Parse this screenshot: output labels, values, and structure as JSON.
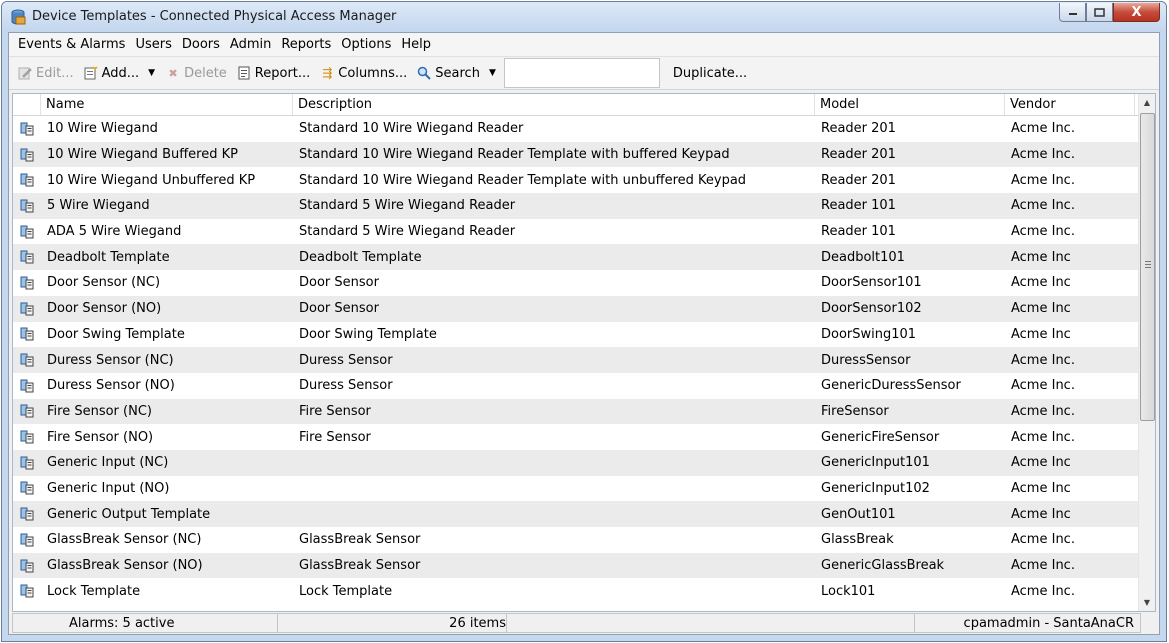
{
  "window": {
    "title": "Device Templates - Connected Physical Access Manager",
    "icon": "database-icon",
    "controls": {
      "minimize": "minimize-icon",
      "maximize": "maximize-icon",
      "close": "X"
    }
  },
  "menubar": {
    "items": [
      "Events & Alarms",
      "Users",
      "Doors",
      "Admin",
      "Reports",
      "Options",
      "Help"
    ]
  },
  "toolbar": {
    "edit_label": "Edit...",
    "add_label": "Add...",
    "delete_label": "Delete",
    "report_label": "Report...",
    "columns_label": "Columns...",
    "search_label": "Search",
    "search_value": "",
    "duplicate_label": "Duplicate..."
  },
  "table": {
    "columns": [
      "Name",
      "Description",
      "Model",
      "Vendor"
    ],
    "rows": [
      {
        "name": "10 Wire Wiegand",
        "description": "Standard 10 Wire Wiegand Reader",
        "model": "Reader 201",
        "vendor": "Acme Inc."
      },
      {
        "name": "10 Wire Wiegand Buffered KP",
        "description": "Standard 10 Wire Wiegand Reader Template with buffered Keypad",
        "model": "Reader 201",
        "vendor": "Acme Inc."
      },
      {
        "name": "10 Wire Wiegand Unbuffered KP",
        "description": "Standard 10 Wire Wiegand Reader Template with unbuffered Keypad",
        "model": "Reader 201",
        "vendor": "Acme Inc."
      },
      {
        "name": "5 Wire Wiegand",
        "description": "Standard 5 Wire Wiegand Reader",
        "model": "Reader 101",
        "vendor": "Acme Inc."
      },
      {
        "name": "ADA 5 Wire Wiegand",
        "description": "Standard 5 Wire Wiegand Reader",
        "model": "Reader 101",
        "vendor": "Acme Inc."
      },
      {
        "name": "Deadbolt Template",
        "description": "Deadbolt Template",
        "model": "Deadbolt101",
        "vendor": "Acme Inc"
      },
      {
        "name": "Door Sensor (NC)",
        "description": "Door Sensor",
        "model": "DoorSensor101",
        "vendor": "Acme Inc"
      },
      {
        "name": "Door Sensor (NO)",
        "description": "Door Sensor",
        "model": "DoorSensor102",
        "vendor": "Acme Inc"
      },
      {
        "name": "Door Swing Template",
        "description": "Door Swing Template",
        "model": "DoorSwing101",
        "vendor": "Acme Inc"
      },
      {
        "name": "Duress Sensor (NC)",
        "description": "Duress Sensor",
        "model": "DuressSensor",
        "vendor": "Acme Inc."
      },
      {
        "name": "Duress Sensor (NO)",
        "description": "Duress Sensor",
        "model": "GenericDuressSensor",
        "vendor": "Acme Inc."
      },
      {
        "name": "Fire Sensor (NC)",
        "description": "Fire Sensor",
        "model": "FireSensor",
        "vendor": "Acme Inc."
      },
      {
        "name": "Fire Sensor (NO)",
        "description": "Fire Sensor",
        "model": "GenericFireSensor",
        "vendor": "Acme Inc."
      },
      {
        "name": "Generic Input (NC)",
        "description": "",
        "model": "GenericInput101",
        "vendor": "Acme Inc"
      },
      {
        "name": "Generic Input (NO)",
        "description": "",
        "model": "GenericInput102",
        "vendor": "Acme Inc"
      },
      {
        "name": "Generic Output Template",
        "description": "",
        "model": "GenOut101",
        "vendor": "Acme Inc"
      },
      {
        "name": "GlassBreak Sensor (NC)",
        "description": "GlassBreak Sensor",
        "model": "GlassBreak",
        "vendor": "Acme Inc."
      },
      {
        "name": "GlassBreak Sensor (NO)",
        "description": "GlassBreak Sensor",
        "model": "GenericGlassBreak",
        "vendor": "Acme Inc."
      },
      {
        "name": "Lock Template",
        "description": "Lock Template",
        "model": "Lock101",
        "vendor": "Acme Inc."
      }
    ]
  },
  "statusbar": {
    "alarms": "Alarms: 5 active",
    "item_count": "26 items",
    "user": "cpamadmin - SantaAnaCR"
  }
}
